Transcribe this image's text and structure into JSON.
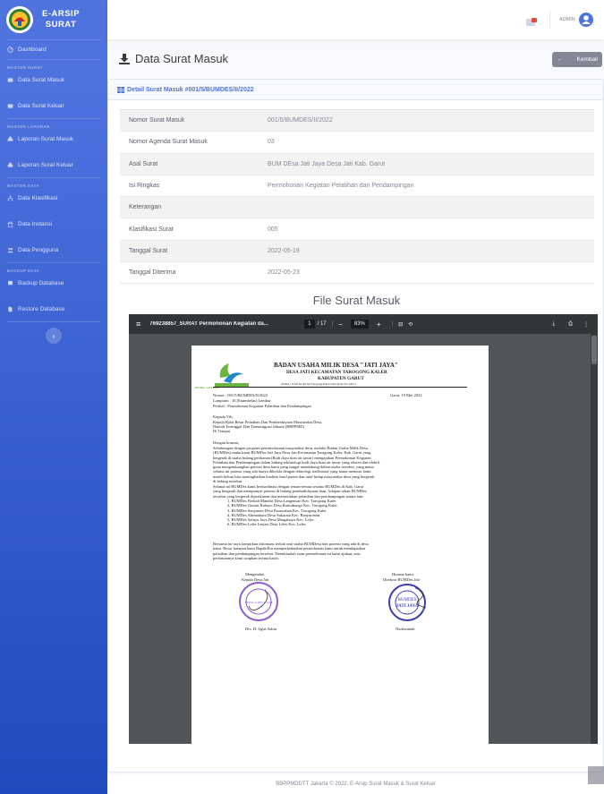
{
  "brand": {
    "line1": "E-ARSIP",
    "line2": "SURAT"
  },
  "sidebar": {
    "dashboard": "Dashboard",
    "section_master_surat": "MASTER SURAT",
    "surat_masuk": "Data Surat Masuk",
    "surat_keluar": "Data Surat Keluar",
    "section_master_laporan": "MASTER LAPORAN",
    "laporan_masuk": "Laporan Surat Masuk",
    "laporan_keluar": "Laporan Surat Keluar",
    "section_master_data": "MASTER DATA",
    "klasifikasi": "Data Klasifikasi",
    "instansi": "Data Instansi",
    "pengguna": "Data Pengguna",
    "section_backup": "BACKUP DATA",
    "backup": "Backup Database",
    "restore": "Restore Database"
  },
  "topbar": {
    "user": "ADMIN"
  },
  "page": {
    "title": "Data Surat Masuk",
    "back_label": "Kembali"
  },
  "card": {
    "header": "Detail Surat Masuk #001/5/BUMDES/II/2022"
  },
  "detail": [
    {
      "label": "Nomor Surat Masuk",
      "value": "001/5/BUMDES/II/2022"
    },
    {
      "label": "Nomor Agenda Surat Masuk",
      "value": "03"
    },
    {
      "label": "Asal Surat",
      "value": "BUM DEsa Jati Jaya Desa Jati Kab. Garut"
    },
    {
      "label": "Isi Ringkas",
      "value": "Permohonan Kegiatan Pelatihan dan Pendampingan"
    },
    {
      "label": "Keterangan",
      "value": ""
    },
    {
      "label": "Klasifikasi Surat",
      "value": "005"
    },
    {
      "label": "Tanggal Surat",
      "value": "2022-05-19"
    },
    {
      "label": "Tanggal Diterima",
      "value": "2022-05-23"
    }
  ],
  "file_section": {
    "title": "File Surat Masuk"
  },
  "pdf": {
    "filename": "769238857_SURAT Permohonan Kegiatan da...",
    "page": "1",
    "pages": "/ 17",
    "zoom": "83%"
  },
  "letter": {
    "org": "BADAN USAHA MILIK DESA \"JATI JAYA\"",
    "sub1": "DESA JATI KECAMATAN TAROGONG KALER",
    "sub2": "KABUPATEN GARUT",
    "addr": "Alamat : Jl.Jati No.49 Jati Tarogong Kaler Garut Kode Pos 44151",
    "nomor": "Nomor      : 001/5/BUMDES/II/2022",
    "date": "Garut, 19 Mei 2022",
    "lampiran": "Lampiran  : 16 (Enambelas) Lembar",
    "perihal": "Perihal      : Permohonan Kegiatan Pelatihan dan Pendampingan",
    "to1": "Kepada Yth,",
    "to2": "Kepala Balai Besar Pelatihan Dan Pemberdayaan Masyarakat Desa,",
    "to3": "Daerah Tertinggal Dan Transmigrasi Jakarta (BBPPMD)",
    "to4": "Di Tempat",
    "greet": "Dengan hormat,",
    "p1": [
      "Sehubungan dengan program pemberdayaan masyarakat desa, melalui Badan Usaha Milik Desa",
      "(BUMDes) maka kami BUMDes Jati Jaya Desa Jati Kecamatan Tarogong Kaler, Kab. Garut yang",
      "bergerak di usaha bidang perikanan (Budi daya ikan air tawar) mengajukan Permohonan Kegiatan",
      "Pelatihan dan Pendampingan dalam bidang tekhnologi budi daya ikan air tawar yang efisien dan efektif",
      "guna mengembangkan potensi desa kami yang sangat mendukung dalam usaha tersebut, yang mana",
      "selama ini potensi yang ada hanya dikelola dengan teknologi tradisional yang mana menurut kami",
      "masih belum bisa meningkatkan kualitas hasil panen dan taraf hidup masyarakat desa yang bergerak",
      "di bidang tersebut."
    ],
    "p2": [
      "Selama ini BUMDes kami berkordinasi dengan teman-teman sesama BUMDes di Kab. Garut",
      "yang bergerak dan mempunyai potensi di bidang pembudidayaan ikan. Adapun rekan BUMDes",
      "tersebut yang bergerak diperikanan dan memerlukan pelatihan dan pendampingan antara lain:"
    ],
    "list": [
      "1.   BUMDes Berkah Mandiri Desa Langensari Kec. Tarogong Kaler",
      "2.   BUMDes Guntur Rahayu Desa Rancabango Kec. Tarogong Kaler",
      "3.   BUMDes Sauyunan Desa Pasawahan Kec. Tarogong Kaler",
      "4.   BUMDes Abimantara Desa Sukarata Kec. Banyuresmi",
      "5.   BUMDes Saluyu Jaya Desa Margahayu Kec. Leles",
      "6.   BUMDes Leles Lestari Desa Leles Kec. Leles"
    ],
    "p3": [
      "Bersama ini saya lampirkan informasi terkait unit usaha BUMDesa dan potensi yang ada di desa",
      "kami. Besar harapan kami Bapak/Ibu memperkenankan permohonan kami untuk mendapatkan",
      "pelatihan dan pendampingan tersebut. Demikianlah surat permohonan ini kami ajukan, atas",
      "perhatiannya kami ucapkan terima kasih."
    ],
    "sign_left_1": "Mengetahui",
    "sign_left_2": "Kepala Desa Jati",
    "sign_right_1": "Hormat kami",
    "sign_right_2": "Direktur BUMDes Jati",
    "name_left": "Drs. H. Agus Salim",
    "name_right": "Nurhasanah",
    "stamp_left": "KEPALA DESA JATI",
    "stamp_right_1": "BUMDES",
    "stamp_right_2": "JATI JAYA",
    "logo_text": "BUMDes JATI JAYA"
  },
  "footer": {
    "text": "BBPPMDDTT Jakarta © 2022, E-Arsip Surat Masuk & Surat Keluar"
  },
  "colors": {
    "primary": "#4e73df",
    "sidebar_dark": "#224abe",
    "secondary": "#858796"
  }
}
